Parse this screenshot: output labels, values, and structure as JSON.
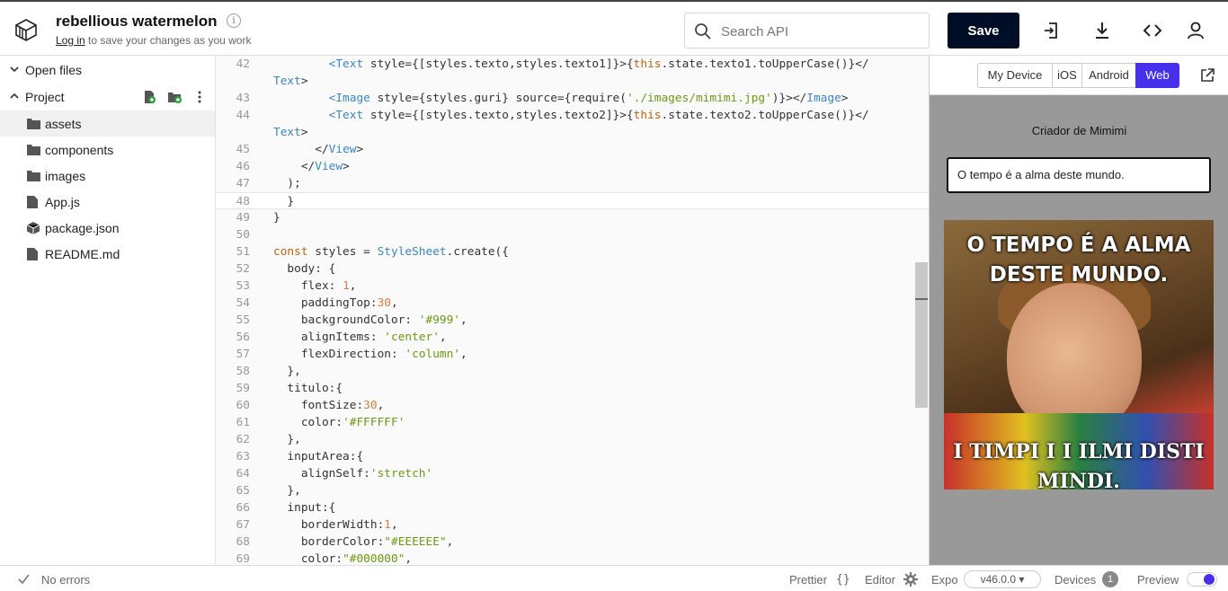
{
  "header": {
    "project_name": "rebellious watermelon",
    "login_link": "Log in",
    "login_suffix": " to save your changes as you work",
    "search_placeholder": "Search API",
    "save_label": "Save"
  },
  "sidebar": {
    "open_files": "Open files",
    "project": "Project",
    "items": [
      {
        "label": "assets",
        "icon": "folder-icon"
      },
      {
        "label": "components",
        "icon": "folder-icon"
      },
      {
        "label": "images",
        "icon": "folder-icon"
      },
      {
        "label": "App.js",
        "icon": "file-icon"
      },
      {
        "label": "package.json",
        "icon": "package-icon"
      },
      {
        "label": "README.md",
        "icon": "file-icon"
      }
    ]
  },
  "editor": {
    "lines": [
      {
        "n": "42",
        "indent": "        ",
        "parts": [
          [
            "t",
            "<Text"
          ],
          [
            "",
            " style={[styles.texto,styles.texto1]}>{"
          ],
          [
            "th",
            "this"
          ],
          [
            "",
            ".state.texto1.toUpperCase()}</"
          ]
        ]
      },
      {
        "n": "",
        "indent": "",
        "parts": [
          [
            "t",
            "Text"
          ],
          [
            "",
            ">"
          ]
        ]
      },
      {
        "n": "43",
        "indent": "        ",
        "parts": [
          [
            "t",
            "<Image"
          ],
          [
            "",
            " style={styles.guri} source={require("
          ],
          [
            "s",
            "'./images/mimimi.jpg'"
          ],
          [
            "",
            ")}></"
          ],
          [
            "t",
            "Image"
          ],
          [
            "",
            ">"
          ]
        ]
      },
      {
        "n": "44",
        "indent": "        ",
        "parts": [
          [
            "t",
            "<Text"
          ],
          [
            "",
            " style={[styles.texto,styles.texto2]}>{"
          ],
          [
            "th",
            "this"
          ],
          [
            "",
            ".state.texto2.toUpperCase()}</"
          ]
        ]
      },
      {
        "n": "",
        "indent": "",
        "parts": [
          [
            "t",
            "Text"
          ],
          [
            "",
            ">"
          ]
        ]
      },
      {
        "n": "45",
        "indent": "      ",
        "parts": [
          [
            "",
            "</"
          ],
          [
            "t",
            "View"
          ],
          [
            "",
            ">"
          ]
        ]
      },
      {
        "n": "46",
        "indent": "    ",
        "parts": [
          [
            "",
            "</"
          ],
          [
            "t",
            "View"
          ],
          [
            "",
            ">"
          ]
        ]
      },
      {
        "n": "47",
        "indent": "  ",
        "parts": [
          [
            "",
            ");"
          ]
        ]
      },
      {
        "n": "48",
        "indent": "  ",
        "parts": [
          [
            "",
            "}"
          ]
        ]
      },
      {
        "n": "49",
        "indent": "",
        "parts": [
          [
            "",
            "}"
          ]
        ]
      },
      {
        "n": "50",
        "indent": "",
        "parts": []
      },
      {
        "n": "51",
        "indent": "",
        "parts": [
          [
            "k",
            "const"
          ],
          [
            "",
            " styles = "
          ],
          [
            "t",
            "StyleSheet"
          ],
          [
            "",
            ".create({"
          ]
        ]
      },
      {
        "n": "52",
        "indent": "  ",
        "parts": [
          [
            "",
            "body: {"
          ]
        ]
      },
      {
        "n": "53",
        "indent": "    ",
        "parts": [
          [
            "",
            "flex: "
          ],
          [
            "n",
            "1"
          ],
          [
            "",
            ","
          ]
        ]
      },
      {
        "n": "54",
        "indent": "    ",
        "parts": [
          [
            "",
            "paddingTop:"
          ],
          [
            "n",
            "30"
          ],
          [
            "",
            ","
          ]
        ]
      },
      {
        "n": "55",
        "indent": "    ",
        "parts": [
          [
            "",
            "backgroundColor: "
          ],
          [
            "s",
            "'#999'"
          ],
          [
            "",
            ","
          ]
        ]
      },
      {
        "n": "56",
        "indent": "    ",
        "parts": [
          [
            "",
            "alignItems: "
          ],
          [
            "s",
            "'center'"
          ],
          [
            "",
            ","
          ]
        ]
      },
      {
        "n": "57",
        "indent": "    ",
        "parts": [
          [
            "",
            "flexDirection: "
          ],
          [
            "s",
            "'column'"
          ],
          [
            "",
            ","
          ]
        ]
      },
      {
        "n": "58",
        "indent": "  ",
        "parts": [
          [
            "",
            "},"
          ]
        ]
      },
      {
        "n": "59",
        "indent": "  ",
        "parts": [
          [
            "",
            "titulo:{"
          ]
        ]
      },
      {
        "n": "60",
        "indent": "    ",
        "parts": [
          [
            "",
            "fontSize:"
          ],
          [
            "n",
            "30"
          ],
          [
            "",
            ","
          ]
        ]
      },
      {
        "n": "61",
        "indent": "    ",
        "parts": [
          [
            "",
            "color:"
          ],
          [
            "s",
            "'#FFFFFF'"
          ]
        ]
      },
      {
        "n": "62",
        "indent": "  ",
        "parts": [
          [
            "",
            "},"
          ]
        ]
      },
      {
        "n": "63",
        "indent": "  ",
        "parts": [
          [
            "",
            "inputArea:{"
          ]
        ]
      },
      {
        "n": "64",
        "indent": "    ",
        "parts": [
          [
            "",
            "alignSelf:"
          ],
          [
            "s",
            "'stretch'"
          ]
        ]
      },
      {
        "n": "65",
        "indent": "  ",
        "parts": [
          [
            "",
            "},"
          ]
        ]
      },
      {
        "n": "66",
        "indent": "  ",
        "parts": [
          [
            "",
            "input:{"
          ]
        ]
      },
      {
        "n": "67",
        "indent": "    ",
        "parts": [
          [
            "",
            "borderWidth:"
          ],
          [
            "n",
            "1"
          ],
          [
            "",
            ","
          ]
        ]
      },
      {
        "n": "68",
        "indent": "    ",
        "parts": [
          [
            "",
            "borderColor:"
          ],
          [
            "s",
            "\"#EEEEEE\""
          ],
          [
            "",
            ","
          ]
        ]
      },
      {
        "n": "69",
        "indent": "    ",
        "parts": [
          [
            "",
            "color:"
          ],
          [
            "s",
            "\"#000000\""
          ],
          [
            "",
            ","
          ]
        ]
      }
    ],
    "highlight_line": "48"
  },
  "preview": {
    "tabs": [
      "My Device",
      "iOS",
      "Android",
      "Web"
    ],
    "active_tab": "Web",
    "app_title": "Criador de Mimimi",
    "input_value": "O tempo é a alma deste mundo.",
    "meme_top": "O TEMPO É A ALMA DESTE MUNDO.",
    "meme_bottom": "I TIMPI I I ILMI DISTI MINDI."
  },
  "footer": {
    "status": "No errors",
    "prettier": "Prettier",
    "editor": "Editor",
    "expo": "Expo",
    "version": "v46.0.0 ▾",
    "devices": "Devices",
    "devices_count": "1",
    "preview": "Preview"
  },
  "colors": {
    "accent": "#4630eb",
    "save_bg": "#000d26",
    "preview_bg": "#999999"
  }
}
